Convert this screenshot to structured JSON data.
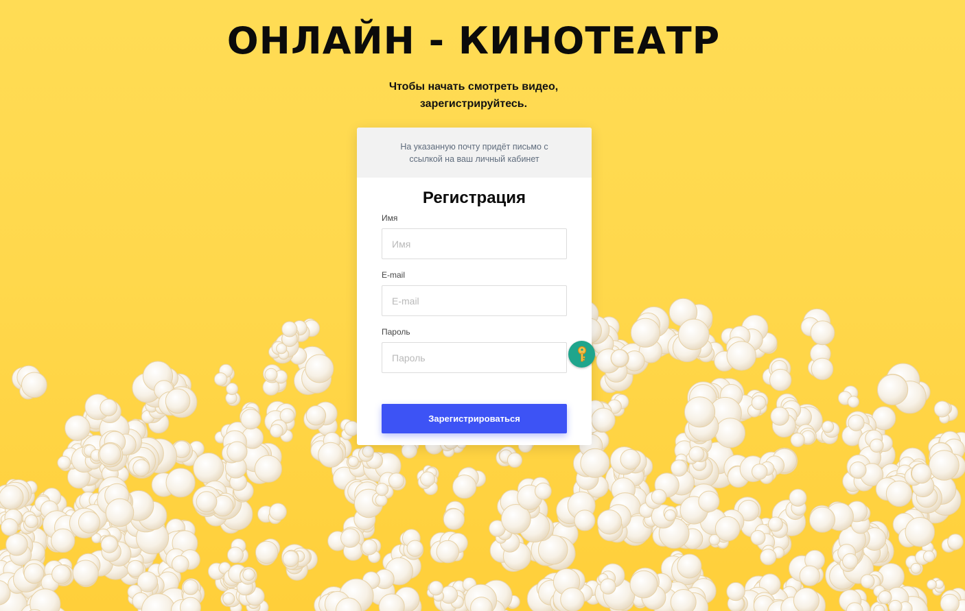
{
  "hero": {
    "title": "ОНЛАЙН - КИНОТЕАТР",
    "subtitle": "Чтобы начать смотреть видео, зарегистрируйтесь."
  },
  "card": {
    "note": "На указанную почту придёт письмо с ссылкой на ваш личный кабинет",
    "title": "Регистрация"
  },
  "form": {
    "name": {
      "label": "Имя",
      "placeholder": "Имя",
      "value": ""
    },
    "email": {
      "label": "E-mail",
      "placeholder": "E-mail",
      "value": ""
    },
    "password": {
      "label": "Пароль",
      "placeholder": "Пароль",
      "value": ""
    },
    "submit_label": "Зарегистрироваться"
  },
  "icons": {
    "password_manager": "key-icon",
    "background": "popcorn-background"
  },
  "colors": {
    "background": "#ffd94f",
    "button": "#3d53f5",
    "key_badge": "#1fa58c",
    "card_note_bg": "#f2f2f2"
  }
}
